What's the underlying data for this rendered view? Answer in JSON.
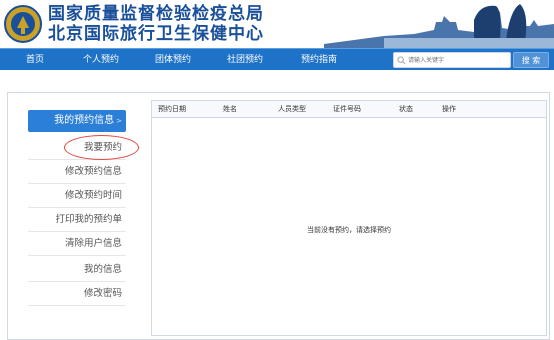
{
  "header": {
    "title": "国家质量监督检验检疫总局",
    "subtitle": "北京国际旅行卫生保健中心",
    "logo_icon": "emblem-icon",
    "skyline_icon": "city-skyline-icon"
  },
  "nav": {
    "items": [
      "首页",
      "个人预约",
      "团体预约",
      "社团预约",
      "预约指南"
    ],
    "search_placeholder": "请输入关键字",
    "search_button": "搜 索"
  },
  "sidebar": {
    "active": "我的预约信息",
    "active_arrow": ">",
    "items": [
      "我要预约",
      "修改预约信息",
      "修改预约时间",
      "打印我的预约单",
      "清除用户信息",
      "我的信息",
      "修改密码"
    ]
  },
  "table": {
    "columns": [
      "预约日期",
      "姓名",
      "人员类型",
      "证件号码",
      "状态",
      "操作"
    ],
    "empty_message": "当前没有预约，请选择预约"
  },
  "colors": {
    "brand": "#1e73c9",
    "title": "#1a4f9a",
    "accent": "#2c7fd6",
    "highlight": "#e0483d"
  }
}
